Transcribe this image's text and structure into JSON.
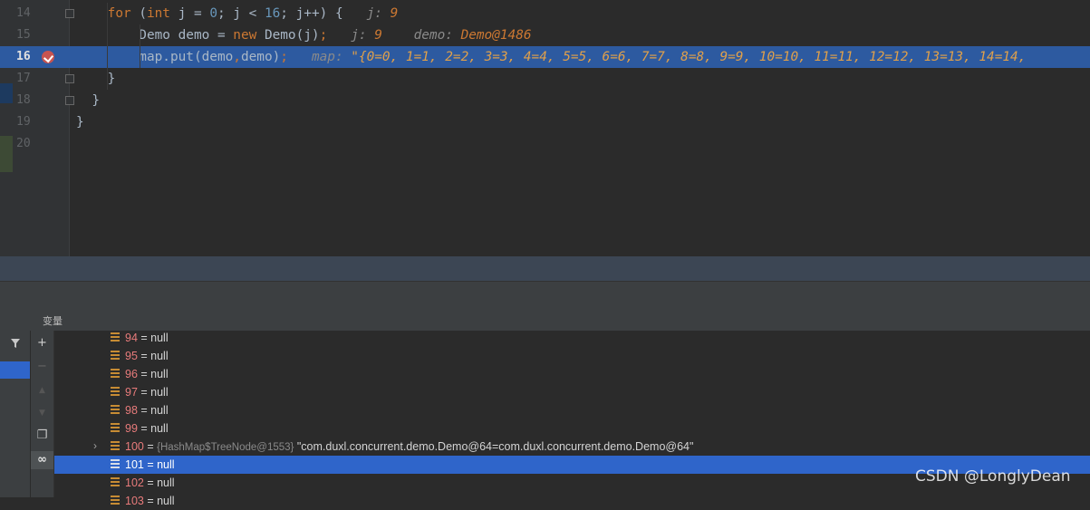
{
  "editor": {
    "lines": [
      {
        "no": "14",
        "parts": [
          {
            "t": "    "
          },
          {
            "t": "for",
            "c": "kw"
          },
          {
            "t": " ("
          },
          {
            "t": "int",
            "c": "kw"
          },
          {
            "t": " j = "
          },
          {
            "t": "0",
            "c": "num"
          },
          {
            "t": "; j < "
          },
          {
            "t": "16",
            "c": "num"
          },
          {
            "t": "; j++) {  "
          },
          {
            "t": " j: ",
            "c": "hint"
          },
          {
            "t": "9",
            "c": "hintval"
          }
        ]
      },
      {
        "no": "15",
        "parts": [
          {
            "t": "        Demo demo = "
          },
          {
            "t": "new",
            "c": "kw"
          },
          {
            "t": " Demo(j)"
          },
          {
            "t": ";",
            "c": "kw"
          },
          {
            "t": "  "
          },
          {
            "t": " j: ",
            "c": "hint"
          },
          {
            "t": "9",
            "c": "hintval"
          },
          {
            "t": "    "
          },
          {
            "t": "demo: ",
            "c": "hint"
          },
          {
            "t": "Demo@1486",
            "c": "hintval"
          }
        ]
      },
      {
        "no": "16",
        "parts": [
          {
            "t": "        map.put(demo"
          },
          {
            "t": ",",
            "c": "kw"
          },
          {
            "t": "demo)"
          },
          {
            "t": ";",
            "c": "kw"
          },
          {
            "t": "   "
          },
          {
            "t": "map: ",
            "c": "hint"
          },
          {
            "t": "\"{0=0, 1=1, 2=2, 3=3, 4=4, 5=5, 6=6, 7=7, 8=8, 9=9, 10=10, 11=11, 12=12, 13=13, 14=14,",
            "c": "hintstr"
          }
        ]
      },
      {
        "no": "17",
        "parts": [
          {
            "t": "    }"
          }
        ]
      },
      {
        "no": "18",
        "parts": [
          {
            "t": "  }"
          }
        ]
      },
      {
        "no": "19",
        "parts": [
          {
            "t": "}"
          }
        ]
      },
      {
        "no": "20",
        "parts": []
      }
    ]
  },
  "panel": {
    "title": "变量"
  },
  "toolbar": {
    "add": "+",
    "remove": "−",
    "up": "▲",
    "down": "▼",
    "copy": "❐",
    "watch": "∞"
  },
  "variables": [
    {
      "key": "94",
      "rest": " = null"
    },
    {
      "key": "95",
      "rest": " = null"
    },
    {
      "key": "96",
      "rest": " = null"
    },
    {
      "key": "97",
      "rest": " = null"
    },
    {
      "key": "98",
      "rest": " = null"
    },
    {
      "key": "99",
      "rest": " = null"
    },
    {
      "key": "100",
      "rest": " = ",
      "type": "{HashMap$TreeNode@1553}",
      "value": " \"com.duxl.concurrent.demo.Demo@64=com.duxl.concurrent.demo.Demo@64\"",
      "expandable": true
    },
    {
      "key": "101",
      "rest": " = null",
      "selected": true
    },
    {
      "key": "102",
      "rest": " = null"
    },
    {
      "key": "103",
      "rest": " = null"
    }
  ],
  "watermark": "CSDN @LonglyDean",
  "colors": {
    "keyword": "#cc7832",
    "number": "#6897bb",
    "highlight": "#2d5aa0",
    "selection": "#2f65ca",
    "breakpoint": "#c75450"
  }
}
